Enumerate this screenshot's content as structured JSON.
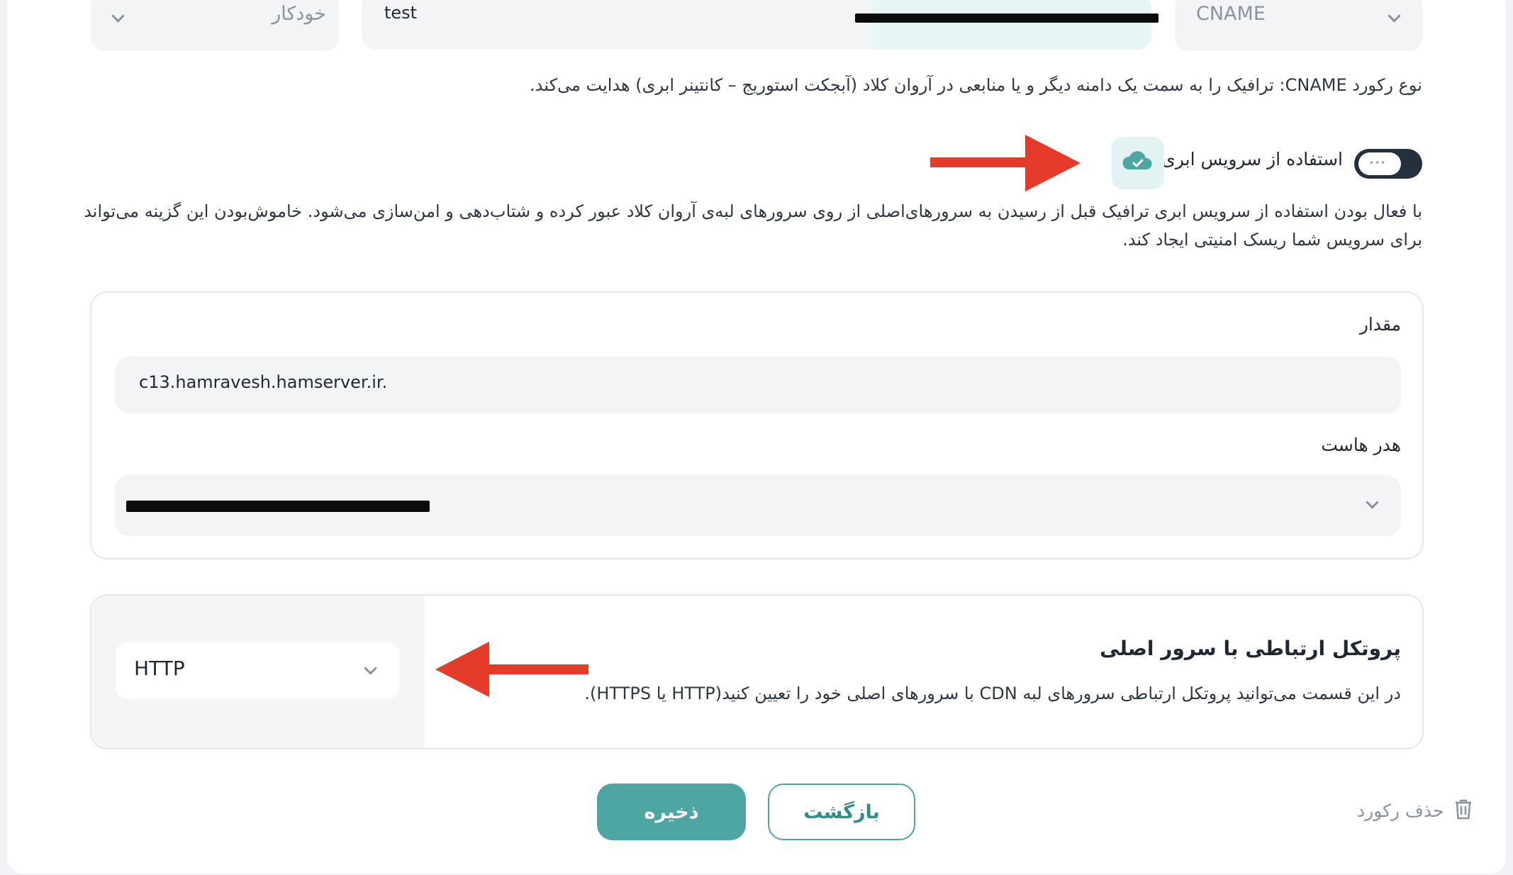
{
  "top_row": {
    "ttl_value": "خودکار",
    "name_value": "test",
    "type_value": "CNAME"
  },
  "cname_description": "نوع رکورد CNAME: ترافیک را به سمت یک دامنه دیگر و یا منابعی در آروان کلاد (آبجکت استوریج – کانتینر ابری) هدایت می‌کند.",
  "cloud_service": {
    "label": "استفاده از سرویس ابری",
    "enabled": true,
    "description_line1": "با فعال بودن استفاده از سرویس ابری ترافیک قبل از رسیدن به سرورهای‌اصلی از روی سرورهای لبه‌ی آروان کلاد عبور کرده و شتاب‌دهی و امن‌سازی می‌شود. خاموش‌بودن این گزینه می‌تواند",
    "description_line2": "برای سرویس شما ریسک امنیتی ایجاد کند."
  },
  "value_card": {
    "value_label": "مقدار",
    "value_text": "c13.hamravesh.hamserver.ir.",
    "host_header_label": "هدر هاست"
  },
  "protocol_card": {
    "title": "پروتکل ارتباطی با سرور اصلی",
    "description": "در این قسمت می‌توانید پروتکل ارتباطی سرورهای لبه CDN با سرورهای اصلی خود را تعیین کنید(HTTP یا HTTPS).",
    "selected": "HTTP"
  },
  "actions": {
    "save": "ذخیره",
    "back": "بازگشت",
    "delete": "حذف رکورد"
  },
  "colors": {
    "accent": "#4ea6a2",
    "annotation_arrow": "#e43b2b",
    "toggle_on": "#26303d"
  },
  "icons": [
    "chevron-down-icon",
    "cloud-check-icon",
    "trash-icon"
  ]
}
